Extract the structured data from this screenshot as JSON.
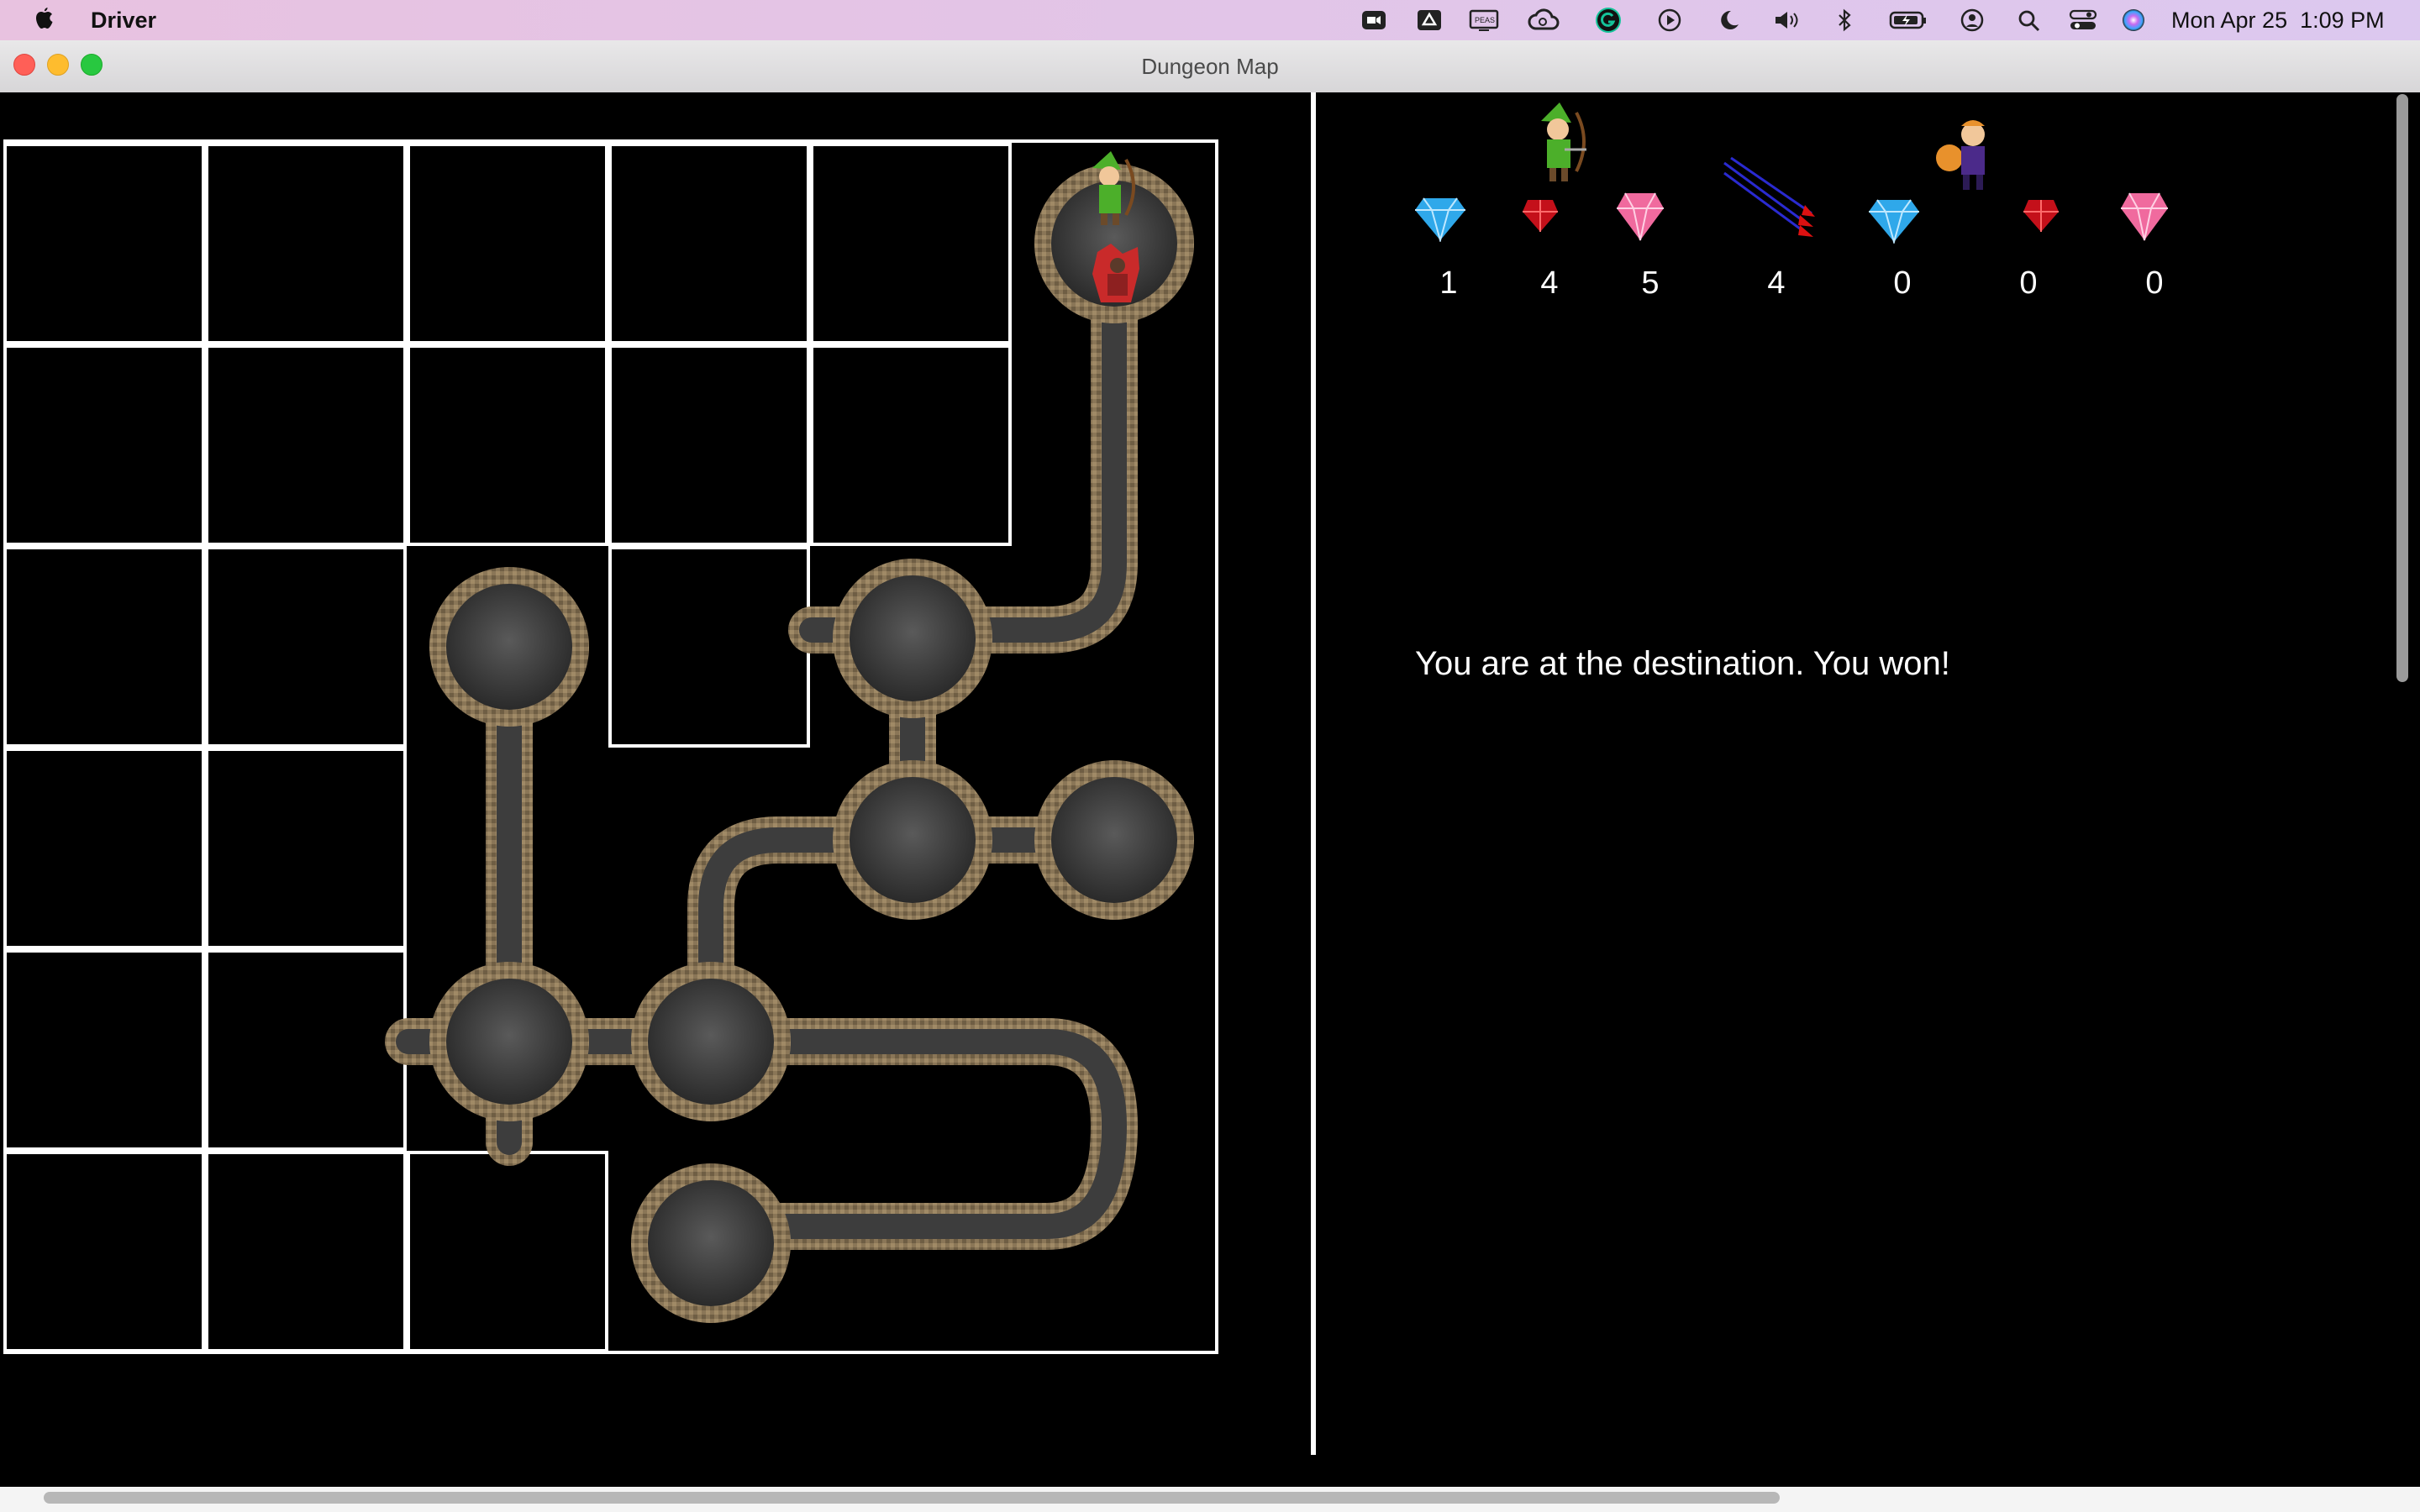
{
  "menubar": {
    "apple_icon": "apple-icon",
    "app_name": "Driver",
    "status_icons": [
      "zoom-icon",
      "drive-icon",
      "cast-icon",
      "creative-cloud-icon",
      "grammarly-icon",
      "play-icon",
      "moon-icon",
      "volume-icon",
      "bluetooth-icon",
      "battery-icon",
      "user-icon",
      "search-icon",
      "control-center-icon",
      "siri-icon"
    ],
    "datetime": "Mon Apr 25  1:09 PM"
  },
  "window": {
    "title": "Dungeon Map",
    "controls": [
      "close",
      "minimize",
      "maximize"
    ]
  },
  "colors": {
    "close": "#ff5f57",
    "minimize": "#febc2e",
    "maximize": "#28c840",
    "background": "#000000",
    "grid_line": "#ffffff",
    "tunnel_stone": "#8a7657",
    "tunnel_floor": "#444444"
  },
  "inventory": {
    "player_label": "player-archer",
    "thief_label": "thief",
    "player": [
      {
        "item": "sapphire-icon",
        "count": "1"
      },
      {
        "item": "ruby-icon",
        "count": "4"
      },
      {
        "item": "diamond-icon",
        "count": "5"
      },
      {
        "item": "arrows-icon",
        "count": "4"
      }
    ],
    "thief": [
      {
        "item": "sapphire-icon",
        "count": "0"
      },
      {
        "item": "ruby-icon",
        "count": "0"
      },
      {
        "item": "diamond-icon",
        "count": "0"
      }
    ]
  },
  "message": "You are at the destination. You won!"
}
